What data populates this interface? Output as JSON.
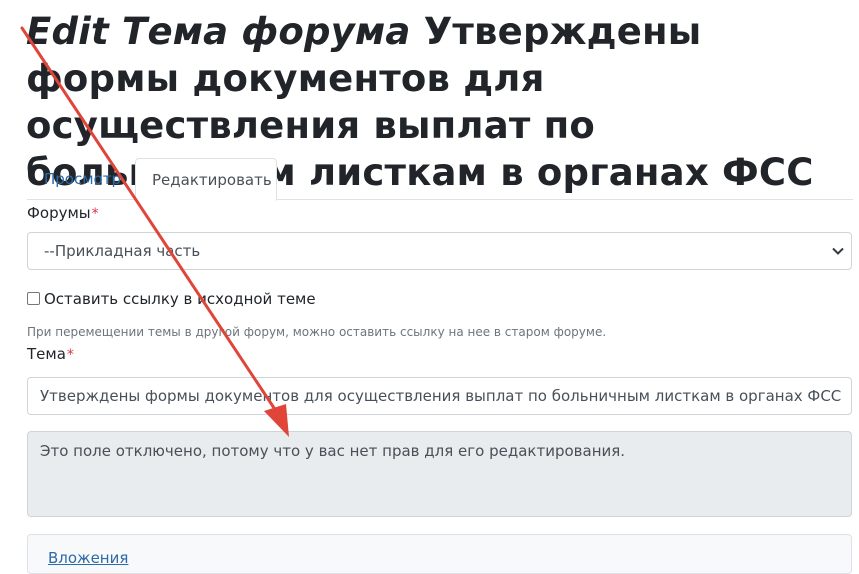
{
  "title": {
    "prefix": "Edit Тема форума",
    "text": "Утверждены формы документов для осуществления выплат по больничным листкам в органах ФСС"
  },
  "tabs": [
    {
      "label": "Просмотр",
      "active": false
    },
    {
      "label": "Редактировать",
      "active": true
    }
  ],
  "forums_field": {
    "label": "Форумы",
    "required_mark": "*",
    "selected": "--Прикладная часть"
  },
  "leave_link": {
    "label": "Оставить ссылку в исходной теме",
    "checked": false,
    "help": "При перемещении темы в другой форум, можно оставить ссылку на нее в старом форуме."
  },
  "topic_field": {
    "label": "Тема",
    "required_mark": "*",
    "value": "Утверждены формы документов для осуществления выплат по больничным листкам в органах ФСС"
  },
  "body_field": {
    "disabled_message": "Это поле отключено, потому что у вас нет прав для его редактирования."
  },
  "attachments": {
    "label": "Вложения"
  },
  "colors": {
    "annotation_arrow": "#e0453a",
    "link": "#2c6aa8",
    "required": "#dc3545",
    "disabled_bg": "#e9ecef"
  },
  "icons": {
    "select_arrow": "chevron-down-icon"
  }
}
